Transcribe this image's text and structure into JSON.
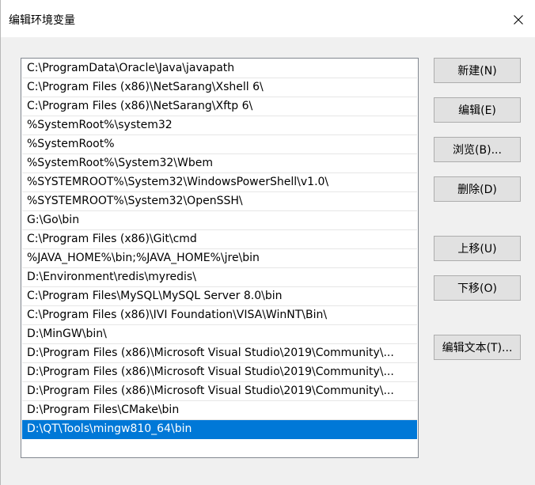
{
  "window": {
    "title": "编辑环境变量",
    "close_icon": "close-icon"
  },
  "path_list": {
    "items": [
      "C:\\ProgramData\\Oracle\\Java\\javapath",
      "C:\\Program Files (x86)\\NetSarang\\Xshell 6\\",
      "C:\\Program Files (x86)\\NetSarang\\Xftp 6\\",
      "%SystemRoot%\\system32",
      "%SystemRoot%",
      "%SystemRoot%\\System32\\Wbem",
      "%SYSTEMROOT%\\System32\\WindowsPowerShell\\v1.0\\",
      "%SYSTEMROOT%\\System32\\OpenSSH\\",
      "G:\\Go\\bin",
      "C:\\Program Files (x86)\\Git\\cmd",
      "%JAVA_HOME%\\bin;%JAVA_HOME%\\jre\\bin",
      "D:\\Environment\\redis\\myredis\\",
      "C:\\Program Files\\MySQL\\MySQL Server 8.0\\bin",
      "C:\\Program Files (x86)\\IVI Foundation\\VISA\\WinNT\\Bin\\",
      "D:\\MinGW\\bin\\",
      "D:\\Program Files (x86)\\Microsoft Visual Studio\\2019\\Community\\...",
      "D:\\Program Files (x86)\\Microsoft Visual Studio\\2019\\Community\\...",
      "D:\\Program Files (x86)\\Microsoft Visual Studio\\2019\\Community\\...",
      "D:\\Program Files\\CMake\\bin",
      "D:\\QT\\Tools\\mingw810_64\\bin"
    ],
    "selected_index": 19
  },
  "buttons": {
    "new": "新建(N)",
    "edit": "编辑(E)",
    "browse": "浏览(B)...",
    "delete": "删除(D)",
    "move_up": "上移(U)",
    "move_down": "下移(O)",
    "edit_text": "编辑文本(T)..."
  },
  "colors": {
    "selection": "#0078d7",
    "dialog_background": "#f0f0f0",
    "button_face": "#e1e1e1"
  }
}
